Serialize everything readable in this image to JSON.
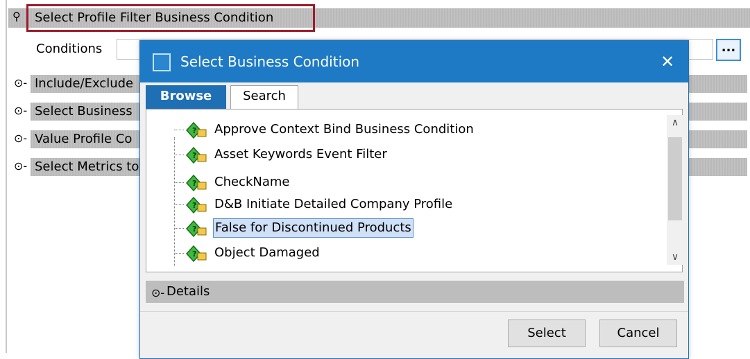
{
  "main": {
    "section_header": "Select Profile Filter Business Condition",
    "conditions_label": "Conditions",
    "conditions_value": "",
    "ellipsis_label": "...",
    "sections": [
      "Include/Exclude",
      "Select Business",
      "Value Profile Co",
      "Select Metrics to"
    ]
  },
  "dialog": {
    "title": "Select Business Condition",
    "close_symbol": "✕",
    "tabs": [
      {
        "label": "Browse",
        "active": true
      },
      {
        "label": "Search",
        "active": false
      }
    ],
    "tree_items": [
      {
        "label": "Approve Context Bind Business Condition",
        "selected": false
      },
      {
        "label": "Asset Keywords Event Filter",
        "selected": false
      },
      {
        "label": "CheckName",
        "selected": false
      },
      {
        "label": "D&B Initiate Detailed Company Profile",
        "selected": false
      },
      {
        "label": "False for Discontinued Products",
        "selected": true
      },
      {
        "label": "Object Damaged",
        "selected": false
      }
    ],
    "details_label": "Details",
    "select_button": "Select",
    "cancel_button": "Cancel",
    "colors": {
      "titlebar": "#1e7ac4",
      "active_tab": "#1e6fb3",
      "highlight_border": "#9e1b2b",
      "selection": "#cfe0f7"
    }
  },
  "icons": {
    "tree_item_icon": "business-condition-icon",
    "section_pin": "pin-icon",
    "expand_pin": "collapsed-pin-icon"
  }
}
